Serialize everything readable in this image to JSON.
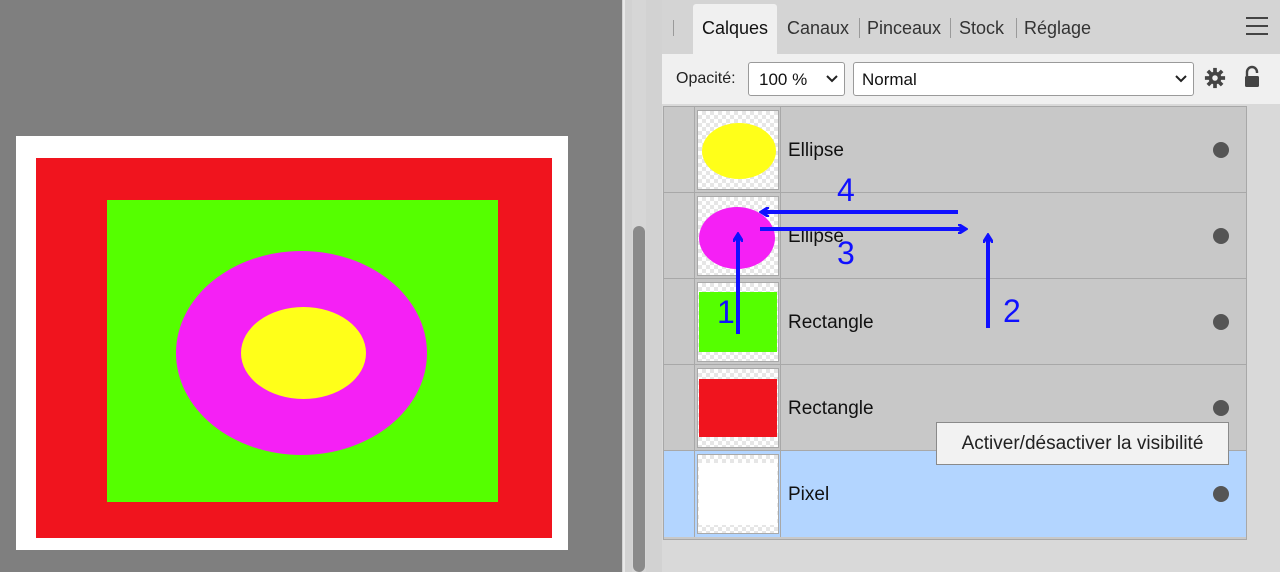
{
  "canvas": {
    "artboard_color": "#ffffff",
    "shapes": {
      "red_rectangle": "#f0141e",
      "green_rectangle": "#55ff00",
      "magenta_ellipse": "#f520f5",
      "yellow_ellipse": "#ffff19"
    }
  },
  "panel": {
    "tabs": [
      {
        "label": "Calques",
        "active": true
      },
      {
        "label": "Canaux",
        "active": false
      },
      {
        "label": "Pinceaux",
        "active": false
      },
      {
        "label": "Stock",
        "active": false
      },
      {
        "label": "Réglage",
        "active": false
      }
    ],
    "menu_icon": "hamburger-icon",
    "options": {
      "opacity_label": "Opacité:",
      "opacity_value": "100 %",
      "blend_mode": "Normal",
      "settings_icon": "gear-icon",
      "lock_icon": "lock-icon"
    },
    "layers": [
      {
        "name": "Ellipse",
        "thumbnail": "yellow-ellipse",
        "selected": false
      },
      {
        "name": "Ellipse",
        "thumbnail": "magenta-ellipse",
        "selected": false
      },
      {
        "name": "Rectangle",
        "thumbnail": "green-rectangle",
        "selected": false
      },
      {
        "name": "Rectangle",
        "thumbnail": "red-rectangle",
        "selected": false
      },
      {
        "name": "Pixel",
        "thumbnail": "white-pixel",
        "selected": true
      }
    ],
    "selected_color": "#b3d5ff",
    "tooltip": "Activer/désactiver la visibilité"
  },
  "annotations": {
    "color": "#1010ff",
    "labels": [
      "1",
      "2",
      "3",
      "4"
    ]
  }
}
